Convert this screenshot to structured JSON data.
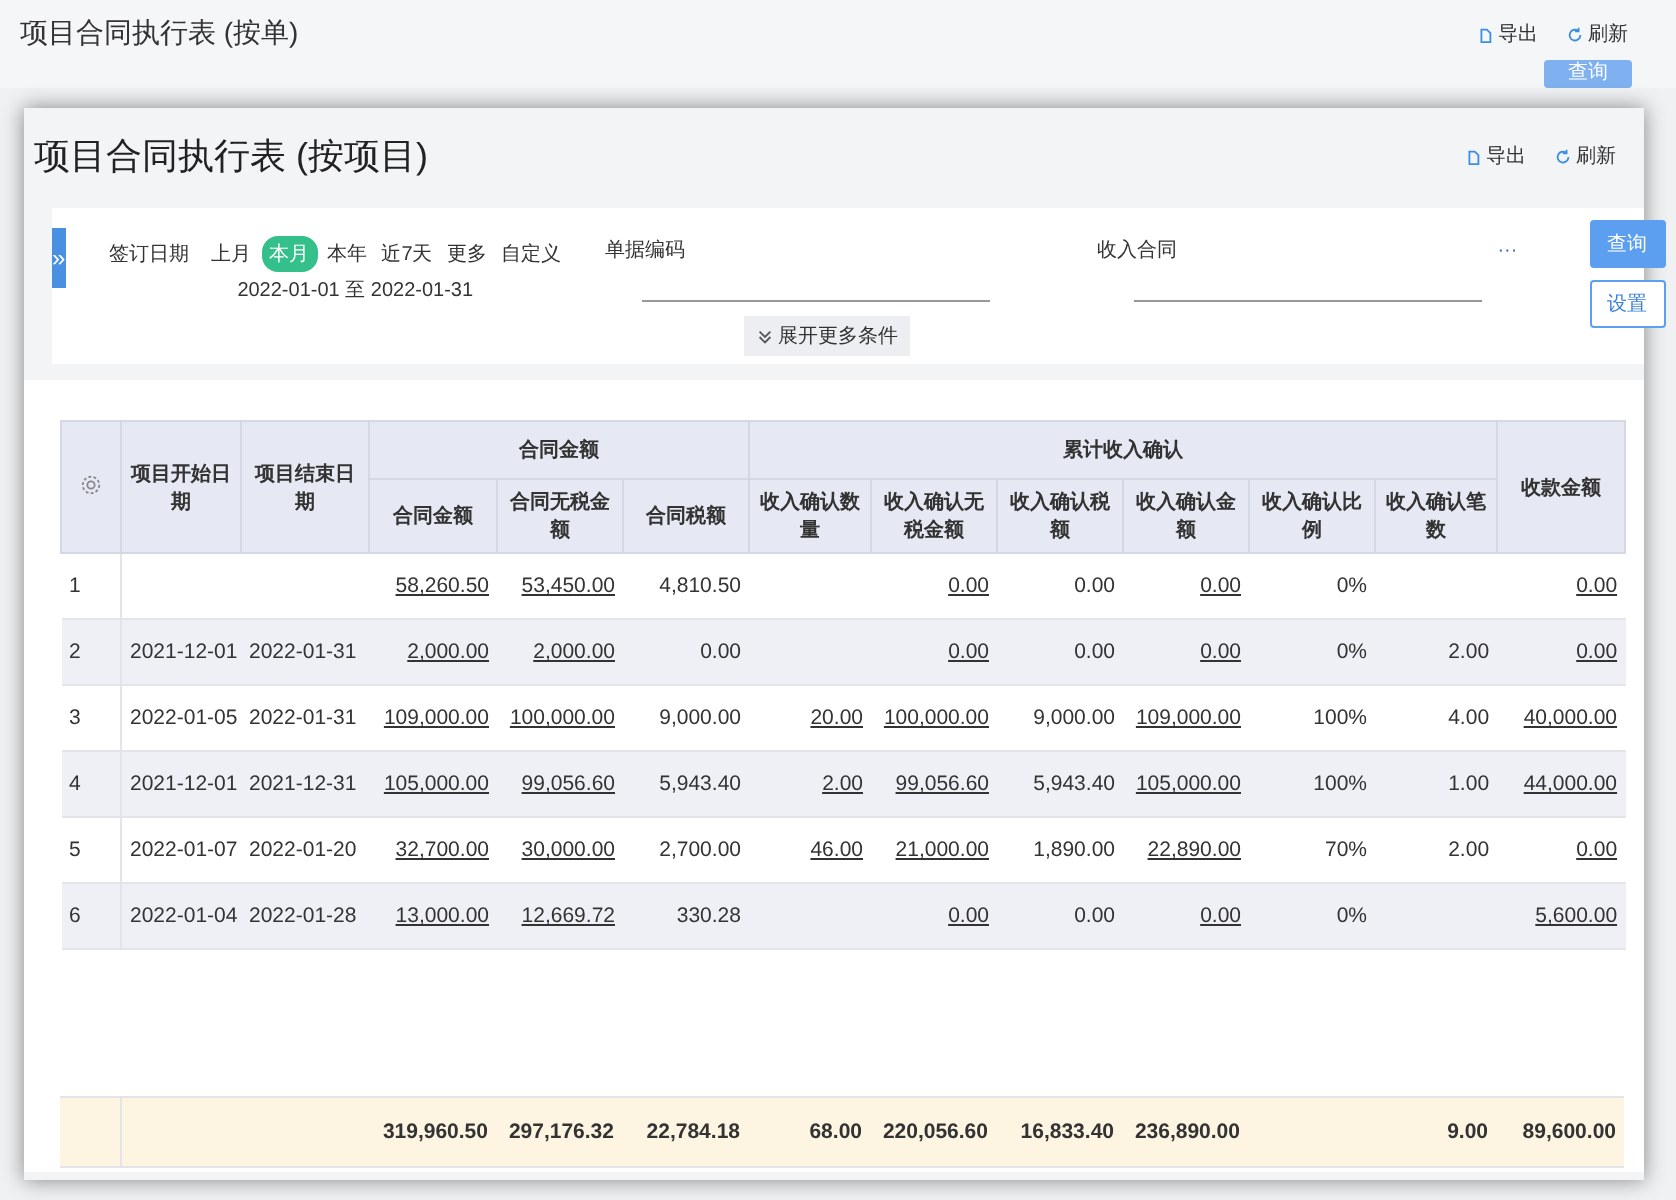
{
  "back_window": {
    "title": "项目合同执行表 (按单)",
    "actions": [
      {
        "kind": "export",
        "label": "导出"
      },
      {
        "kind": "refresh",
        "label": "刷新"
      }
    ],
    "query_button": "查询"
  },
  "window": {
    "title": "项目合同执行表 (按项目)",
    "actions": [
      {
        "kind": "export",
        "label": "导出"
      },
      {
        "kind": "refresh",
        "label": "刷新"
      }
    ]
  },
  "filter": {
    "toggle": "»",
    "date": {
      "label": "签订日期",
      "options": [
        {
          "label": "上月",
          "selected": false
        },
        {
          "label": "本月",
          "selected": true
        },
        {
          "label": "本年",
          "selected": false
        },
        {
          "label": "近7天",
          "selected": false
        },
        {
          "label": "更多",
          "selected": false
        },
        {
          "label": "自定义",
          "selected": false
        }
      ],
      "range": "2022-01-01 至 2022-01-31"
    },
    "fields": [
      {
        "label": "单据编码",
        "more": false
      },
      {
        "label": "收入合同",
        "more": true
      }
    ],
    "more_button": "···",
    "expand_button": "展开更多条件",
    "query_button": "查询",
    "settings_button": "设置"
  },
  "table": {
    "header": [
      {
        "kind": "single",
        "label": "项目开始日期"
      },
      {
        "kind": "single",
        "label": "项目结束日期"
      },
      {
        "kind": "group",
        "label": "合同金额",
        "columns": [
          "合同金额",
          "合同无税金额",
          "合同税额"
        ]
      },
      {
        "kind": "group",
        "label": "累计收入确认",
        "columns": [
          "收入确认数量",
          "收入确认无税金额",
          "收入确认税额",
          "收入确认金额",
          "收入确认比例",
          "收入确认笔数"
        ]
      },
      {
        "kind": "single",
        "label": "收款金额"
      }
    ],
    "rows": [
      {
        "no": {
          "text": "1",
          "link": false
        },
        "contract_amount": {
          "text": "58,260.50",
          "link": true
        },
        "contract_net": {
          "text": "53,450.00",
          "link": true
        },
        "contract_tax": {
          "text": "4,810.50",
          "link": false
        },
        "rec_net": {
          "text": "0.00",
          "link": true
        },
        "rec_tax": {
          "text": "0.00",
          "link": false
        },
        "rec_amount": {
          "text": "0.00",
          "link": true
        },
        "rec_ratio": {
          "text": "0%",
          "link": false
        },
        "received": {
          "text": "0.00",
          "link": true
        }
      },
      {
        "no": {
          "text": "2",
          "link": false
        },
        "start": {
          "text": "2021-12-01",
          "link": false
        },
        "end": {
          "text": "2022-01-31",
          "link": false
        },
        "contract_amount": {
          "text": "2,000.00",
          "link": true
        },
        "contract_net": {
          "text": "2,000.00",
          "link": true
        },
        "contract_tax": {
          "text": "0.00",
          "link": false
        },
        "rec_net": {
          "text": "0.00",
          "link": true
        },
        "rec_tax": {
          "text": "0.00",
          "link": false
        },
        "rec_amount": {
          "text": "0.00",
          "link": true
        },
        "rec_ratio": {
          "text": "0%",
          "link": false
        },
        "rec_count": {
          "text": "2.00",
          "link": false
        },
        "received": {
          "text": "0.00",
          "link": true
        }
      },
      {
        "no": {
          "text": "3",
          "link": false
        },
        "start": {
          "text": "2022-01-05",
          "link": false
        },
        "end": {
          "text": "2022-01-31",
          "link": false
        },
        "contract_amount": {
          "text": "109,000.00",
          "link": true
        },
        "contract_net": {
          "text": "100,000.00",
          "link": true
        },
        "contract_tax": {
          "text": "9,000.00",
          "link": false
        },
        "rec_qty": {
          "text": "20.00",
          "link": true
        },
        "rec_net": {
          "text": "100,000.00",
          "link": true
        },
        "rec_tax": {
          "text": "9,000.00",
          "link": false
        },
        "rec_amount": {
          "text": "109,000.00",
          "link": true
        },
        "rec_ratio": {
          "text": "100%",
          "link": false
        },
        "rec_count": {
          "text": "4.00",
          "link": false
        },
        "received": {
          "text": "40,000.00",
          "link": true
        }
      },
      {
        "no": {
          "text": "4",
          "link": false
        },
        "start": {
          "text": "2021-12-01",
          "link": false
        },
        "end": {
          "text": "2021-12-31",
          "link": false
        },
        "contract_amount": {
          "text": "105,000.00",
          "link": true
        },
        "contract_net": {
          "text": "99,056.60",
          "link": true
        },
        "contract_tax": {
          "text": "5,943.40",
          "link": false
        },
        "rec_qty": {
          "text": "2.00",
          "link": true
        },
        "rec_net": {
          "text": "99,056.60",
          "link": true
        },
        "rec_tax": {
          "text": "5,943.40",
          "link": false
        },
        "rec_amount": {
          "text": "105,000.00",
          "link": true
        },
        "rec_ratio": {
          "text": "100%",
          "link": false
        },
        "rec_count": {
          "text": "1.00",
          "link": false
        },
        "received": {
          "text": "44,000.00",
          "link": true
        }
      },
      {
        "no": {
          "text": "5",
          "link": false
        },
        "start": {
          "text": "2022-01-07",
          "link": false
        },
        "end": {
          "text": "2022-01-20",
          "link": false
        },
        "contract_amount": {
          "text": "32,700.00",
          "link": true
        },
        "contract_net": {
          "text": "30,000.00",
          "link": true
        },
        "contract_tax": {
          "text": "2,700.00",
          "link": false
        },
        "rec_qty": {
          "text": "46.00",
          "link": true
        },
        "rec_net": {
          "text": "21,000.00",
          "link": true
        },
        "rec_tax": {
          "text": "1,890.00",
          "link": false
        },
        "rec_amount": {
          "text": "22,890.00",
          "link": true
        },
        "rec_ratio": {
          "text": "70%",
          "link": false
        },
        "rec_count": {
          "text": "2.00",
          "link": false
        },
        "received": {
          "text": "0.00",
          "link": true
        }
      },
      {
        "no": {
          "text": "6",
          "link": false
        },
        "start": {
          "text": "2022-01-04",
          "link": false
        },
        "end": {
          "text": "2022-01-28",
          "link": false
        },
        "contract_amount": {
          "text": "13,000.00",
          "link": true
        },
        "contract_net": {
          "text": "12,669.72",
          "link": true
        },
        "contract_tax": {
          "text": "330.28",
          "link": false
        },
        "rec_net": {
          "text": "0.00",
          "link": true
        },
        "rec_tax": {
          "text": "0.00",
          "link": false
        },
        "rec_amount": {
          "text": "0.00",
          "link": true
        },
        "rec_ratio": {
          "text": "0%",
          "link": false
        },
        "received": {
          "text": "5,600.00",
          "link": true
        }
      }
    ],
    "totals": {
      "contract_amount": "319,960.50",
      "contract_net": "297,176.32",
      "contract_tax": "22,784.18",
      "rec_qty": "68.00",
      "rec_net": "220,056.60",
      "rec_tax": "16,833.40",
      "rec_amount": "236,890.00",
      "rec_count": "9.00",
      "received": "89,600.00"
    }
  }
}
